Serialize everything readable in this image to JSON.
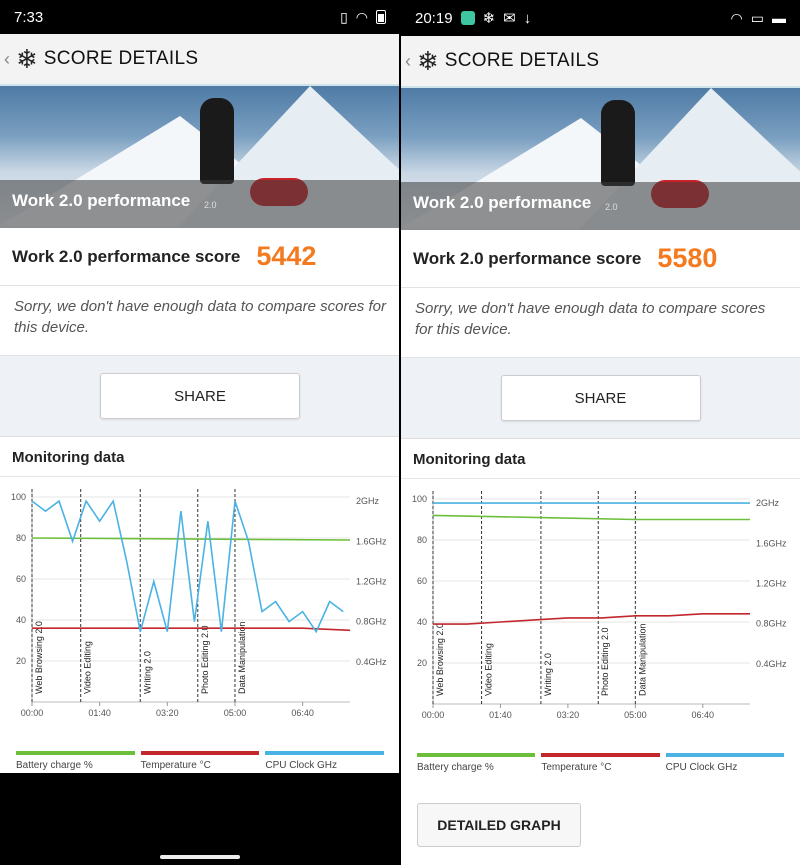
{
  "left": {
    "status": {
      "time": "7:33"
    },
    "app": {
      "title": "SCORE DETAILS"
    },
    "hero": {
      "title": "Work 2.0 performance",
      "version": "2.0"
    },
    "score": {
      "label": "Work 2.0 performance score",
      "value": "5442"
    },
    "compare_text": "Sorry, we don't have enough data to compare scores for this device.",
    "share_label": "SHARE",
    "monitoring_title": "Monitoring data"
  },
  "right": {
    "status": {
      "time": "20:19"
    },
    "app": {
      "title": "SCORE DETAILS"
    },
    "hero": {
      "title": "Work 2.0 performance",
      "version": "2.0"
    },
    "score": {
      "label": "Work 2.0 performance score",
      "value": "5580"
    },
    "compare_text": "Sorry, we don't have enough data to compare scores for this device.",
    "share_label": "SHARE",
    "monitoring_title": "Monitoring data",
    "detailed_label": "DETAILED GRAPH"
  },
  "legend": {
    "battery": "Battery charge %",
    "temperature": "Temperature °C",
    "cpu": "CPU Clock GHz"
  },
  "colors": {
    "accent_score": "#f47a20",
    "battery": "#6dbf3b",
    "temperature": "#c1272d",
    "cpu": "#4ab3e3"
  },
  "chart_data": [
    {
      "type": "line",
      "title": "",
      "x_ticks": [
        "00:00",
        "01:40",
        "03:20",
        "05:00",
        "06:40"
      ],
      "y_left_ticks": [
        "20",
        "40",
        "60",
        "80",
        "100"
      ],
      "y_right_ticks": [
        "0.4GHz",
        "0.8GHz",
        "1.2GHz",
        "1.6GHz",
        "2GHz"
      ],
      "ylim": [
        0,
        100
      ],
      "workloads": [
        "Web Browsing 2.0",
        "Video Editing",
        "Writing 2.0",
        "Photo Editing 2.0",
        "Data Manipulation"
      ],
      "workload_starts_sec": [
        0,
        72,
        160,
        245,
        300
      ],
      "x_range_sec": [
        0,
        470
      ],
      "series": [
        {
          "name": "Battery charge %",
          "x": [
            0,
            470
          ],
          "values": [
            80,
            79
          ]
        },
        {
          "name": "Temperature °C",
          "x": [
            0,
            100,
            200,
            300,
            400,
            470
          ],
          "values": [
            36,
            36,
            36,
            36,
            36,
            35
          ]
        },
        {
          "name": "CPU Clock GHz",
          "x": [
            0,
            20,
            40,
            60,
            80,
            100,
            120,
            140,
            160,
            180,
            200,
            220,
            240,
            260,
            280,
            300,
            320,
            340,
            360,
            380,
            400,
            420,
            440,
            460
          ],
          "values": [
            2.0,
            1.9,
            2.0,
            1.6,
            2.0,
            1.8,
            2.0,
            1.4,
            0.7,
            1.2,
            0.7,
            1.9,
            0.8,
            1.8,
            0.7,
            2.0,
            1.6,
            0.9,
            1.0,
            0.8,
            0.9,
            0.7,
            1.0,
            0.9
          ]
        }
      ]
    },
    {
      "type": "line",
      "title": "",
      "x_ticks": [
        "00:00",
        "01:40",
        "03:20",
        "05:00",
        "06:40"
      ],
      "y_left_ticks": [
        "20",
        "40",
        "60",
        "80",
        "100"
      ],
      "y_right_ticks": [
        "0.4GHz",
        "0.8GHz",
        "1.2GHz",
        "1.6GHz",
        "2GHz"
      ],
      "ylim": [
        0,
        100
      ],
      "workloads": [
        "Web Browsing 2.0",
        "Video Editing",
        "Writing 2.0",
        "Photo Editing 2.0",
        "Data Manipulation"
      ],
      "workload_starts_sec": [
        0,
        72,
        160,
        245,
        300
      ],
      "x_range_sec": [
        0,
        470
      ],
      "series": [
        {
          "name": "Battery charge %",
          "x": [
            0,
            150,
            300,
            470
          ],
          "values": [
            92,
            91,
            90,
            90
          ]
        },
        {
          "name": "Temperature °C",
          "x": [
            0,
            50,
            100,
            150,
            200,
            250,
            300,
            350,
            400,
            450,
            470
          ],
          "values": [
            39,
            39,
            40,
            41,
            42,
            42,
            43,
            43,
            44,
            44,
            44
          ]
        },
        {
          "name": "CPU Clock GHz",
          "x": [
            0,
            470
          ],
          "values": [
            2.0,
            2.0
          ]
        }
      ]
    }
  ]
}
